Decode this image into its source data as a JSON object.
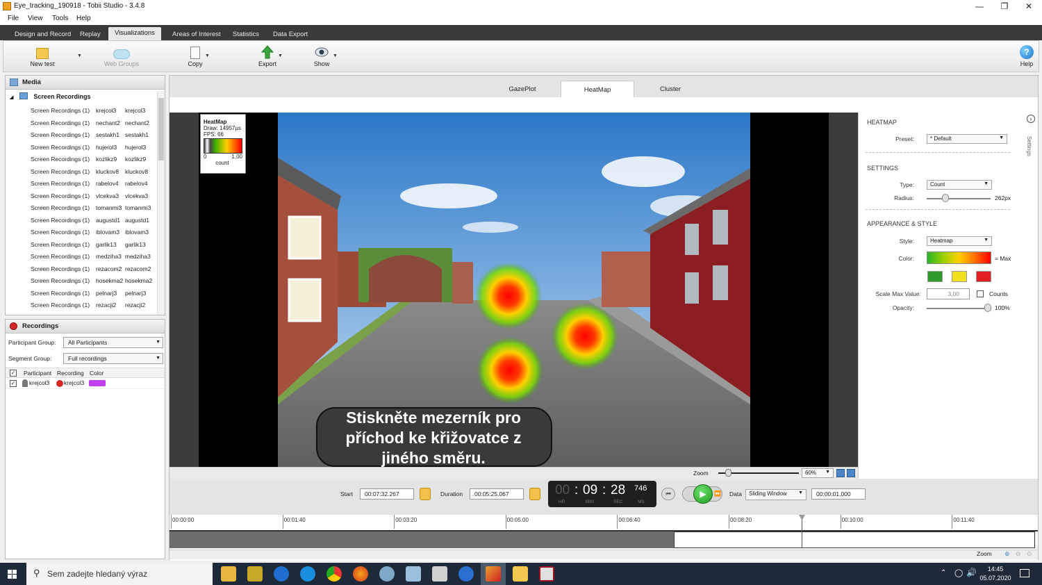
{
  "window": {
    "title": "Eye_tracking_190918 - Tobii Studio - 3.4.8"
  },
  "menu": [
    "File",
    "View",
    "Tools",
    "Help"
  ],
  "main_tabs": [
    "Design and Record",
    "Replay",
    "Visualizations",
    "Areas of Interest",
    "Statistics",
    "Data Export"
  ],
  "toolbar": {
    "new_test": "New test",
    "web_groups": "Web Groups",
    "copy": "Copy",
    "export": "Export",
    "show": "Show",
    "help": "Help"
  },
  "media": {
    "title": "Media",
    "root": "Screen Recordings",
    "rows": [
      [
        "Screen Recordings (1)",
        "krejcol3",
        "krejcol3"
      ],
      [
        "Screen Recordings (1)",
        "nechant2",
        "nechant2"
      ],
      [
        "Screen Recordings (1)",
        "sestakh1",
        "sestakh1"
      ],
      [
        "Screen Recordings (1)",
        "hujerol3",
        "hujerol3"
      ],
      [
        "Screen Recordings (1)",
        "kozlikz9",
        "kozlikz9"
      ],
      [
        "Screen Recordings (1)",
        "kluckov8",
        "kluckov8"
      ],
      [
        "Screen Recordings (1)",
        "rabelov4",
        "rabelov4"
      ],
      [
        "Screen Recordings (1)",
        "vlcekva3",
        "vlcekva3"
      ],
      [
        "Screen Recordings (1)",
        "tomanmi3",
        "tomanmi3"
      ],
      [
        "Screen Recordings (1)",
        "augustd1",
        "augustd1"
      ],
      [
        "Screen Recordings (1)",
        "iblovam3",
        "iblovam3"
      ],
      [
        "Screen Recordings (1)",
        "garlik13",
        "garlik13"
      ],
      [
        "Screen Recordings (1)",
        "medziha3",
        "medziha3"
      ],
      [
        "Screen Recordings (1)",
        "rezacom2",
        "rezacom2"
      ],
      [
        "Screen Recordings (1)",
        "hosekma2",
        "hosekma2"
      ],
      [
        "Screen Recordings (1)",
        "pelnarj3",
        "pelnarj3"
      ],
      [
        "Screen Recordings (1)",
        "rezacji2",
        "rezacji2"
      ]
    ]
  },
  "recordings": {
    "title": "Recordings",
    "participant_group_label": "Participant Group:",
    "participant_group_value": "All Participants",
    "segment_group_label": "Segment Group:",
    "segment_group_value": "Full recordings",
    "col_participant": "Participant",
    "col_recording": "Recording",
    "col_color": "Color",
    "row_participant": "krejcol3",
    "row_recording": "krejcol3",
    "row_color": "#c040f0"
  },
  "viz_tabs": [
    "GazePlot",
    "HeatMap",
    "Cluster"
  ],
  "legend": {
    "title": "HeatMap",
    "draw": "Draw: 14957µs",
    "fps": "FPS: 66",
    "min": "0",
    "max": "1,00",
    "unit": "count"
  },
  "subtitle": "Stiskněte mezerník pro příchod ke křižovatce z jiného směru.",
  "settings": {
    "heatmap_title": "HEATMAP",
    "preset_label": "Preset:",
    "preset_value": "* Default",
    "settings_title": "SETTINGS",
    "type_label": "Type:",
    "type_value": "Count",
    "radius_label": "Radius:",
    "radius_value": "262px",
    "appearance_title": "APPEARANCE & STYLE",
    "style_label": "Style:",
    "style_value": "Heatmap",
    "color_label": "Color:",
    "color_max": "= Max",
    "scale_label": "Scale Max Value:",
    "scale_value": "3,00",
    "counts_label": "Counts",
    "opacity_label": "Opacity:",
    "opacity_value": "100%",
    "side_tab": "Settings",
    "swatches": [
      "#2e9a2e",
      "#f0e020",
      "#e02020"
    ]
  },
  "zoom": {
    "label": "Zoom",
    "value": "60%"
  },
  "playback": {
    "start_label": "Start",
    "start_value": "00:07:32.267",
    "duration_label": "Duration",
    "duration_value": "00:05:25.067",
    "hr": "00",
    "min": "09",
    "sec": "28",
    "ms": "746",
    "hr_label": "HR",
    "min_label": "MIN",
    "sec_label": "SEC",
    "ms_label": "MS",
    "data_label": "Data",
    "data_value": "Sliding Window",
    "window_value": "00:00:01.000"
  },
  "timeline": {
    "ticks": [
      "00:00:00",
      "00:01:40",
      "00:03:20",
      "00:05:00",
      "00:06:40",
      "00:08:20",
      "00:10:00",
      "00:11:40"
    ],
    "zoom_label": "Zoom"
  },
  "taskbar": {
    "search_placeholder": "Sem zadejte hledaný výraz",
    "time": "14:45",
    "date": "05.07.2020"
  }
}
